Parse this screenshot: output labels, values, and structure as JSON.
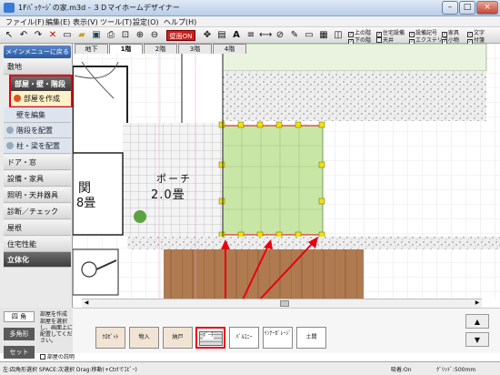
{
  "window": {
    "title": "1Fﾊﾟｯｹｰｼﾞの家.m3d - ３Ｄマイホームデザイナー",
    "minimize": "–",
    "maximize": "□",
    "close": "×"
  },
  "menubar": [
    "ファイル(F)",
    "編集(E)",
    "表示(V)",
    "ツール(T)",
    "設定(O)",
    "ヘルプ(H)"
  ],
  "toolbar": {
    "sokei_button": "壁面ON",
    "checks_row1": [
      "上の階",
      "住宅設備",
      "設備記号",
      "家具",
      "文字"
    ],
    "checks_row2": [
      "下の階",
      "天井",
      "エクステリア",
      "小物",
      "付箋"
    ]
  },
  "left_panel": {
    "main_menu_button": "メインメニューに戻る",
    "items": {
      "site": "敷地",
      "rooms_walls_stairs": "部屋・壁・階段",
      "create_room": "部屋を作成",
      "edit_walls": "壁を編集",
      "place_stairs": "階段を配置",
      "place_pillars": "柱・梁を配置",
      "doors_windows": "ドア・窓",
      "equipment_furniture": "設備・家具",
      "lighting_ceiling": "照明・天井器具",
      "diagnosis_check": "診断／チェック",
      "roof": "屋根",
      "house_performance": "住宅性能",
      "solidify": "立体化"
    }
  },
  "floor_tabs": [
    "地下",
    "1階",
    "2階",
    "3階",
    "4階"
  ],
  "active_floor": "1階",
  "plan": {
    "porch_label": "ポーチ",
    "porch_size": "2.0畳",
    "entrance_partial_1": "関",
    "entrance_partial_2": "8畳"
  },
  "bottom_left": {
    "tab_square": "四 角",
    "tab_polygon": "多角形",
    "tab_set": "セット",
    "panel_title": "部屋を作成",
    "panel_desc": "部屋を選択し、画面上に配置してください。",
    "room_description_check": "部屋の説明"
  },
  "parts": [
    "ｸﾛｾﾞｯﾄ",
    "物入",
    "納戸",
    "ﾎﾟｰﾁ",
    "ﾊﾞﾙｺﾆｰ",
    "ｲﾝﾅｰｶﾞﾚｰｼﾞ",
    "土間"
  ],
  "selected_part": "ﾎﾟｰﾁ",
  "statusbar": {
    "hint": "左:四角形選択 SPACE:次選択 Drag:移動(+Ctrlでｺﾋﾟｰ)",
    "snap": "吸着:On",
    "grid": "ｸﾞﾘｯﾄﾞ:500mm"
  },
  "colors": {
    "highlight_red": "#e8000e",
    "porch_fill": "#c8e6a6",
    "porch_handle": "#f0e010",
    "wood_deck": "#b07a50"
  }
}
